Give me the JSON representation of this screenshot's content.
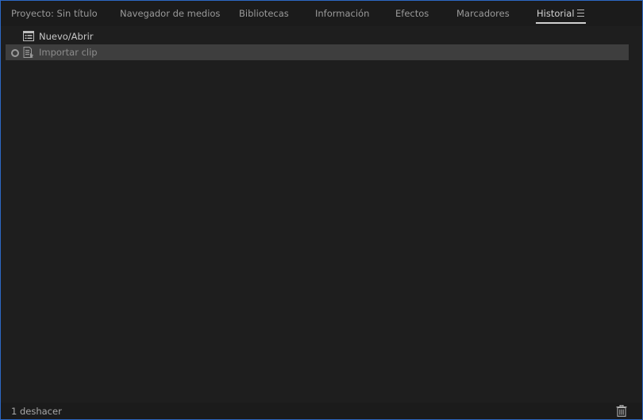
{
  "tabs": [
    {
      "label": "Proyecto: Sin título",
      "active": false
    },
    {
      "label": "Navegador de medios",
      "active": false
    },
    {
      "label": "Bibliotecas",
      "active": false
    },
    {
      "label": "Información",
      "active": false
    },
    {
      "label": "Efectos",
      "active": false
    },
    {
      "label": "Marcadores",
      "active": false
    },
    {
      "label": "Historial",
      "active": true
    }
  ],
  "panel_menu": {
    "icon": "hamburger-menu-icon"
  },
  "history": {
    "items": [
      {
        "label": "Nuevo/Abrir",
        "icon": "new-open-icon",
        "selected": false
      },
      {
        "label": "Importar clip",
        "icon": "import-clip-icon",
        "selected": true
      }
    ]
  },
  "status": {
    "undo_count": "1 deshacer",
    "delete_icon": "trash-icon"
  },
  "colors": {
    "panel_border": "#2d68c4",
    "background": "#1e1e1e",
    "selected_row": "#3e3e3e",
    "active_tab_text": "#d4d4d4",
    "inactive_tab_text": "#9a9a9a"
  }
}
